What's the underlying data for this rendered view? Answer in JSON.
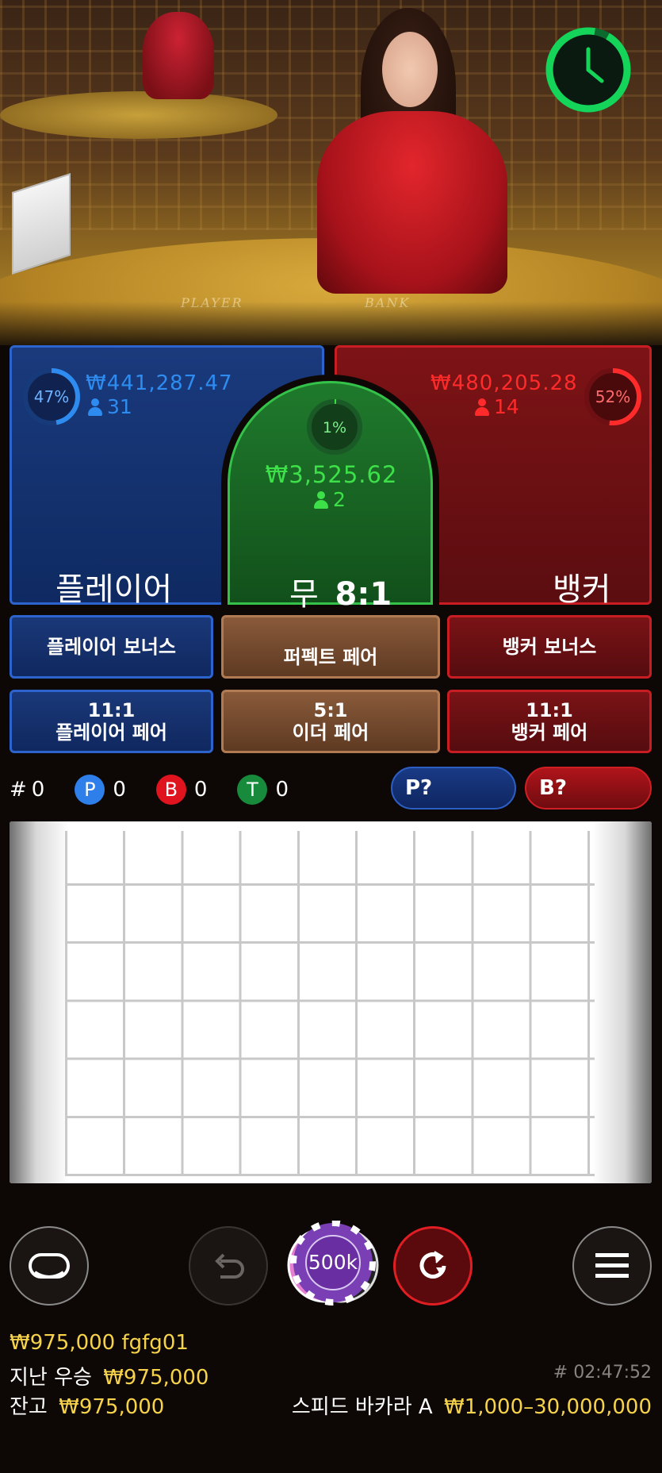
{
  "video": {
    "table_words": [
      "PLAYER",
      "BANK"
    ]
  },
  "colors": {
    "player": "#2c63cc",
    "banker": "#c81d22",
    "tie": "#34c24a",
    "player_text": "#2e8cf0",
    "banker_text": "#ff2b2b",
    "tie_text": "#3ee04a",
    "gold": "#f6d34a",
    "timer": "#14d45a"
  },
  "player": {
    "percent": "47%",
    "percent_value": 47,
    "amount": "₩441,287.47",
    "players": "31",
    "label": "플레이어"
  },
  "banker": {
    "percent": "52%",
    "percent_value": 52,
    "amount": "₩480,205.28",
    "players": "14",
    "label": "뱅커"
  },
  "tie": {
    "percent": "1%",
    "percent_value": 1,
    "amount": "₩3,525.62",
    "players": "2",
    "label": "무",
    "payout": "8:1"
  },
  "side_bets": {
    "player_bonus": "플레이어 보너스",
    "perfect_pair": "퍼펙트 페어",
    "banker_bonus": "뱅커 보너스",
    "player_pair_payout": "11:1",
    "player_pair": "플레이어 페어",
    "either_pair_payout": "5:1",
    "either_pair": "이더 페어",
    "banker_pair_payout": "11:1",
    "banker_pair": "뱅커 페어"
  },
  "stats": {
    "total_prefix": "#",
    "total": "0",
    "p_letter": "P",
    "p": "0",
    "b_letter": "B",
    "b": "0",
    "t_letter": "T",
    "t": "0",
    "player_predict": "P?",
    "banker_predict": "B?"
  },
  "controls": {
    "chip_value": "500k",
    "icons": [
      "video-toggle-icon",
      "undo-icon",
      "repeat-icon",
      "menu-icon"
    ]
  },
  "footer": {
    "bet_amount": "₩975,000",
    "username": "fgfg01",
    "last_win_label": "지난 우승",
    "last_win_value": "₩975,000",
    "balance_label": "잔고",
    "balance_value": "₩975,000",
    "round_id": "# 02:47:52",
    "table_name": "스피드 바카라 A",
    "limits": "₩1,000–30,000,000"
  }
}
